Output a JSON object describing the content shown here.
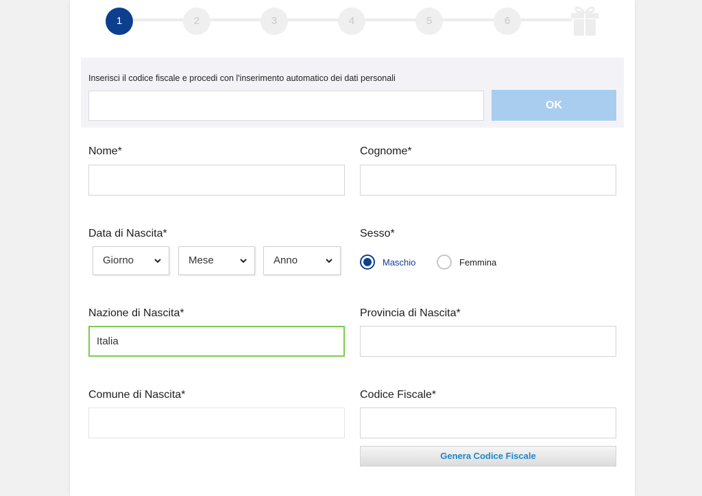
{
  "stepper": {
    "steps": [
      "1",
      "2",
      "3",
      "4",
      "5",
      "6"
    ],
    "active_step": 1,
    "final_icon": "gift-icon"
  },
  "cf_lookup": {
    "label": "Inserisci il codice fiscale e procedi con l'inserimento automatico dei dati personali",
    "input_value": "",
    "ok_label": "OK"
  },
  "form": {
    "nome_label": "Nome*",
    "nome_value": "",
    "cognome_label": "Cognome*",
    "cognome_value": "",
    "data_nascita_label": "Data di Nascita*",
    "giorno": "Giorno",
    "mese": "Mese",
    "anno": "Anno",
    "sesso_label": "Sesso*",
    "sesso_options": [
      "Maschio",
      "Femmina"
    ],
    "sesso_selected": "Maschio",
    "nazione_label": "Nazione di Nascita*",
    "nazione_value": "Italia",
    "provincia_label": "Provincia di Nascita*",
    "provincia_value": "",
    "comune_label": "Comune di Nascita*",
    "comune_value": "",
    "cf_label": "Codice Fiscale*",
    "cf_value": "",
    "genera_label": "Genera Codice Fiscale"
  },
  "colors": {
    "primary": "#0d3f8f",
    "ok_button": "#a9cdee",
    "valid_border": "#7acb4f",
    "link": "#1f86c8"
  }
}
